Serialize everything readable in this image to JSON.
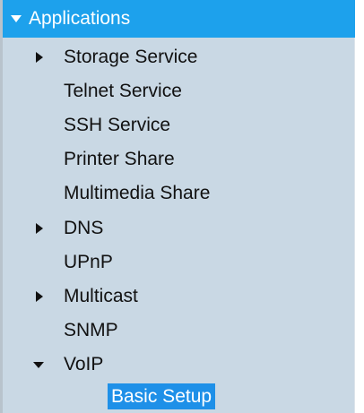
{
  "menu": {
    "section_title": "Applications",
    "items": [
      {
        "label": "Storage Service",
        "icon": "expand-arrow"
      },
      {
        "label": "Telnet Service"
      },
      {
        "label": "SSH Service"
      },
      {
        "label": "Printer Share"
      },
      {
        "label": "Multimedia Share"
      },
      {
        "label": "DNS",
        "icon": "expand-arrow"
      },
      {
        "label": "UPnP"
      },
      {
        "label": "Multicast",
        "icon": "expand-arrow"
      },
      {
        "label": "SNMP"
      },
      {
        "label": "VoIP",
        "icon": "collapse-arrow"
      }
    ],
    "subitems": [
      {
        "label": "Basic Setup",
        "selected": true
      }
    ]
  },
  "colors": {
    "header_bg": "#1da1ec",
    "menu_bg": "#c9d8e4",
    "selected_bg": "#1e90e8"
  }
}
